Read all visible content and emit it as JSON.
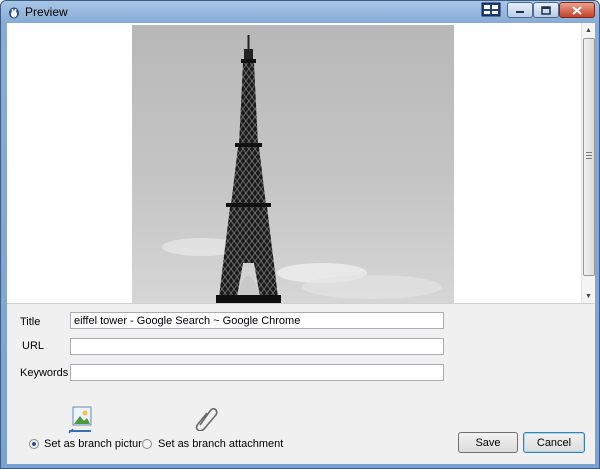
{
  "window": {
    "title": "Preview"
  },
  "form": {
    "title_label": "Title",
    "title_value": "eiffel tower - Google Search ~ Google Chrome",
    "url_label": "URL",
    "url_value": "",
    "keywords_label": "Keywords",
    "keywords_value": ""
  },
  "options": {
    "picture_label": "Set as branch picture",
    "attachment_label": "Set as branch attachment",
    "selected": "picture"
  },
  "buttons": {
    "save": "Save",
    "cancel": "Cancel"
  },
  "icons": [
    "app-icon",
    "layout-icon",
    "minimize-icon",
    "maximize-icon",
    "close-icon",
    "picture-icon",
    "paperclip-icon"
  ],
  "colors": {
    "close_button": "#c4412a",
    "selected_radio": "#2a4f8f",
    "default_button_border": "#3c7fb1"
  }
}
